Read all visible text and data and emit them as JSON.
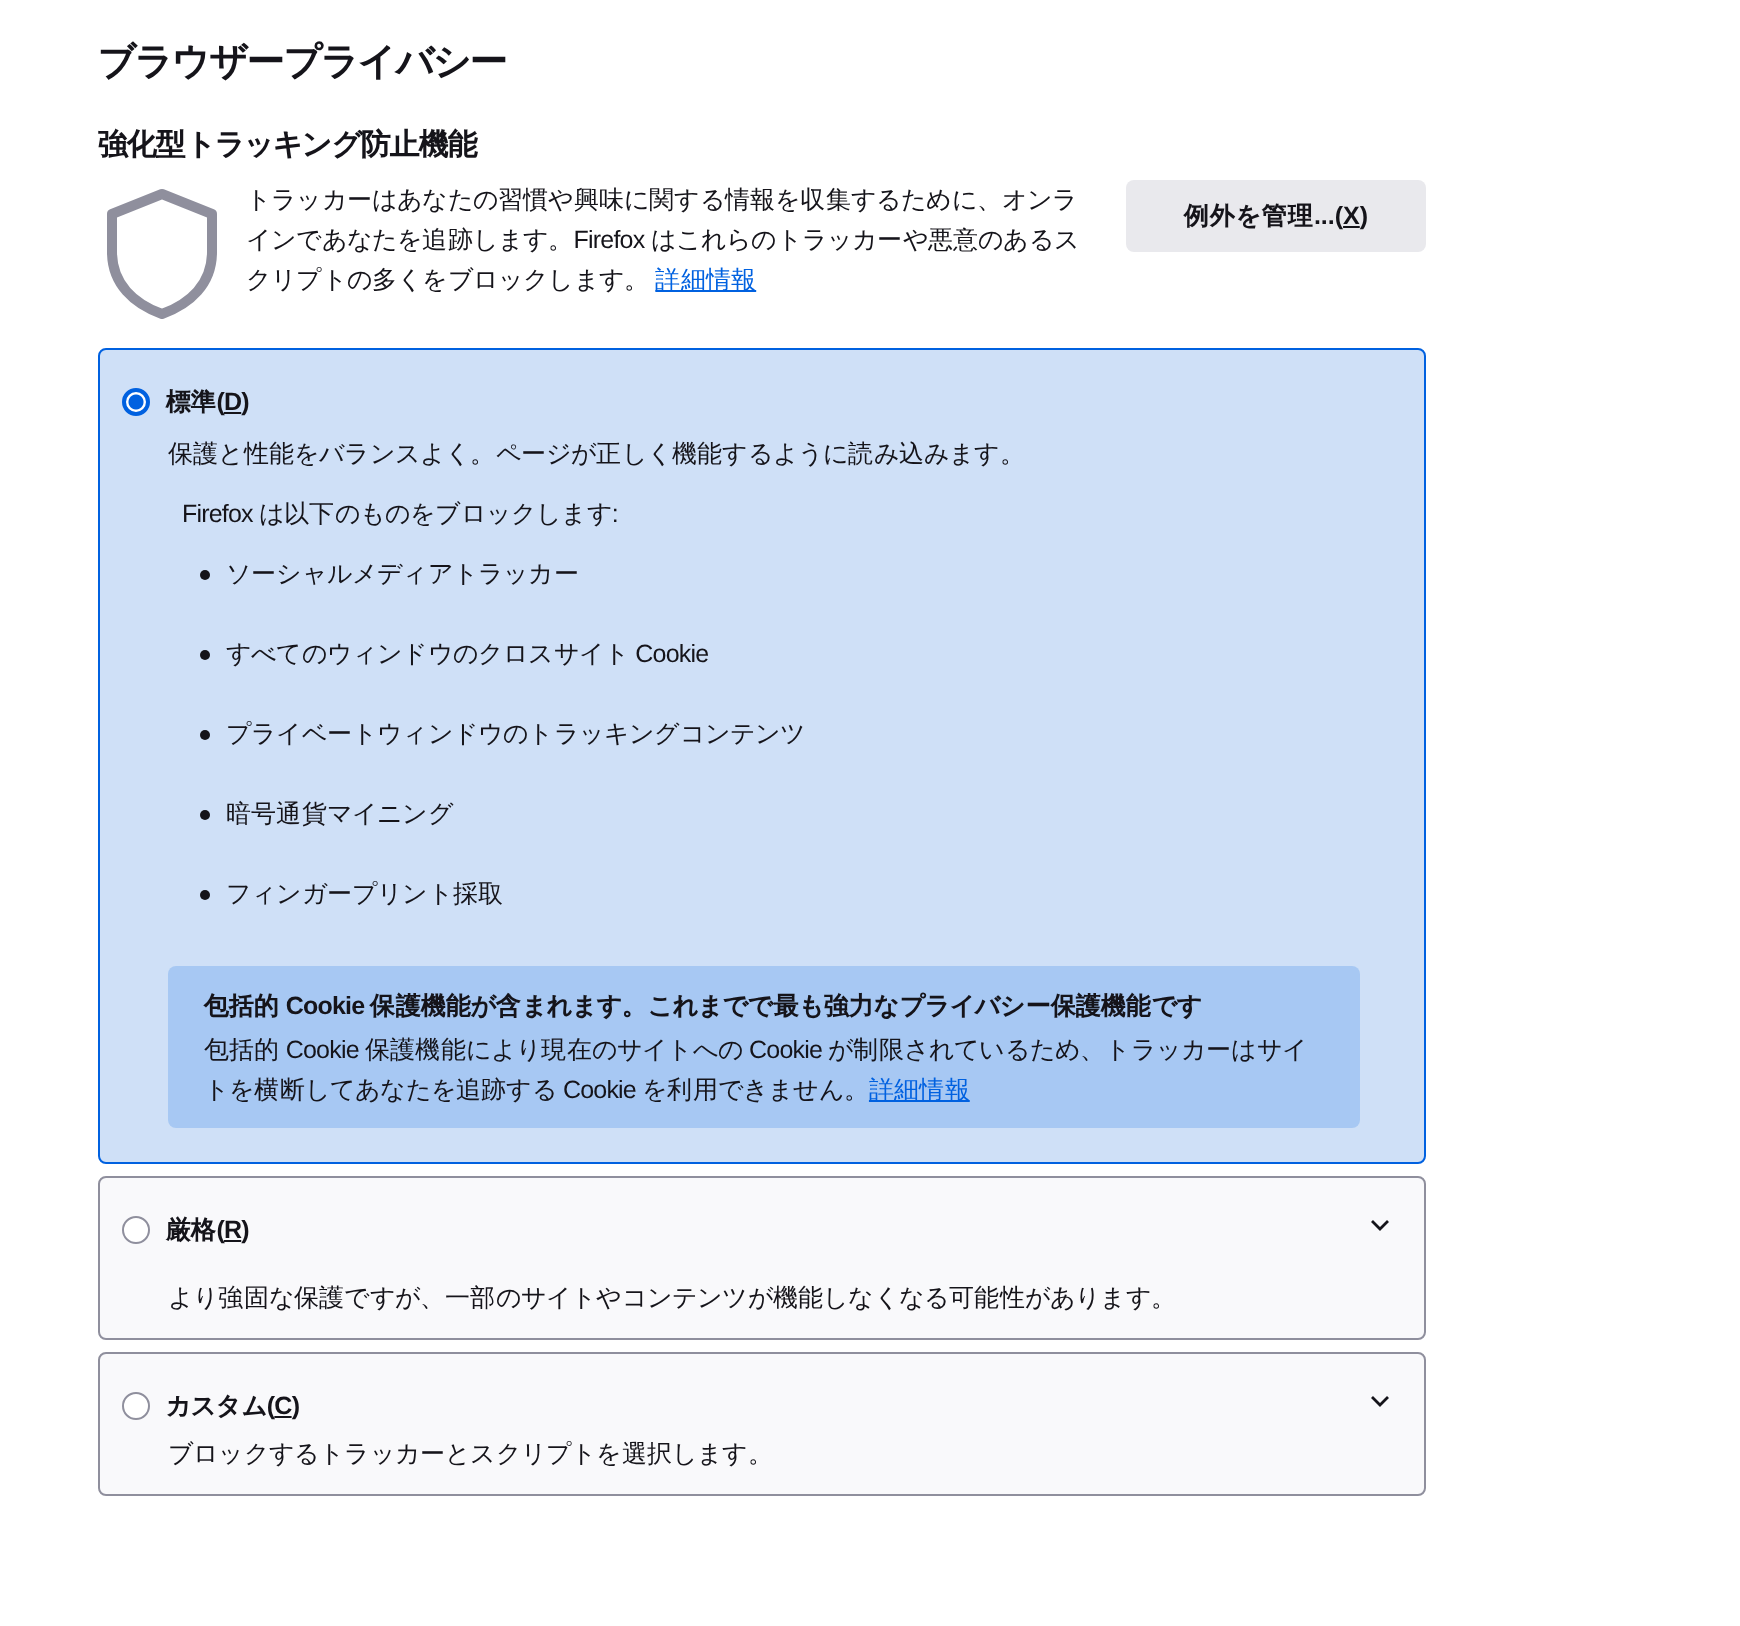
{
  "title": "ブラウザープライバシー",
  "section": {
    "heading": "強化型トラッキング防止機能",
    "description": "トラッカーはあなたの習慣や興味に関する情報を収集するために、オンラインであなたを追跡します。Firefox はこれらのトラッカーや悪意のあるスクリプトの多くをブロックします。",
    "learn_more": "詳細情報",
    "button": {
      "before": "例外を管理...(",
      "accesskey": "X",
      "after": ")"
    }
  },
  "options": [
    {
      "label": {
        "before": "標準(",
        "accesskey": "D",
        "after": ")"
      },
      "selected": true,
      "expanded": true,
      "description": "保護と性能をバランスよく。ページが正しく機能するように読み込みます。",
      "blocks_heading": "Firefox は以下のものをブロックします:",
      "blocks": [
        "ソーシャルメディアトラッカー",
        "すべてのウィンドウのクロスサイト Cookie",
        "プライベートウィンドウのトラッキングコンテンツ",
        "暗号通貨マイニング",
        "フィンガープリント採取"
      ],
      "notice": {
        "title": "包括的 Cookie 保護機能が含まれます。これまでで最も強力なプライバシー保護機能です",
        "text": "包括的 Cookie 保護機能により現在のサイトへの Cookie が制限されているため、トラッカーはサイトを横断してあなたを追跡する Cookie を利用できません。",
        "link": "詳細情報"
      }
    },
    {
      "label": {
        "before": "厳格(",
        "accesskey": "R",
        "after": ")"
      },
      "selected": false,
      "expanded": false,
      "description": "より強固な保護ですが、一部のサイトやコンテンツが機能しなくなる可能性があります。"
    },
    {
      "label": {
        "before": "カスタム(",
        "accesskey": "C",
        "after": ")"
      },
      "selected": false,
      "expanded": false,
      "description": "ブロックするトラッカーとスクリプトを選択します。"
    }
  ]
}
